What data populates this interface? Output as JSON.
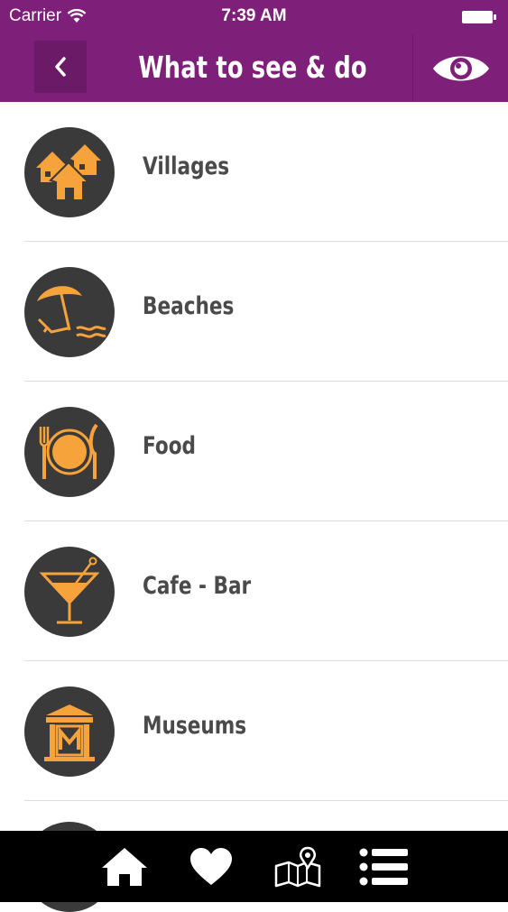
{
  "status_bar": {
    "carrier": "Carrier",
    "time": "7:39 AM",
    "wifi_icon": "wifi-icon",
    "battery_icon": "battery-icon"
  },
  "nav": {
    "title": "What to see & do",
    "back_icon": "chevron-left-icon",
    "view_icon": "eye-icon"
  },
  "colors": {
    "brand_purple": "#7e1f7a",
    "accent_orange": "#f5a33a",
    "icon_bg": "#3a3a3a"
  },
  "categories": [
    {
      "label": "Villages",
      "icon": "houses-icon"
    },
    {
      "label": "Beaches",
      "icon": "beach-umbrella-icon"
    },
    {
      "label": "Food",
      "icon": "plate-cutlery-icon"
    },
    {
      "label": "Cafe - Bar",
      "icon": "cocktail-icon"
    },
    {
      "label": "Museums",
      "icon": "museum-icon"
    }
  ],
  "tabbar": {
    "items": [
      {
        "icon": "home-icon"
      },
      {
        "icon": "heart-icon"
      },
      {
        "icon": "map-icon"
      },
      {
        "icon": "list-icon"
      }
    ]
  }
}
